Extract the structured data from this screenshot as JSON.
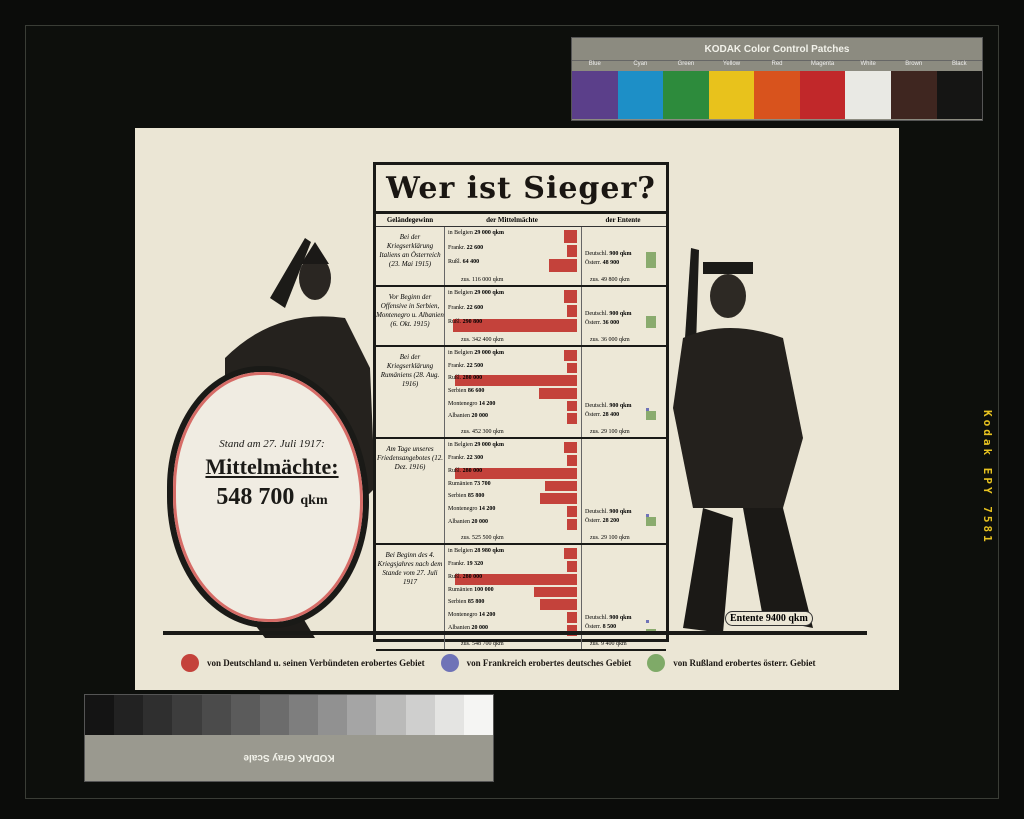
{
  "film_strip": {
    "edge_text": "Kodak EPY 7581"
  },
  "color_card": {
    "title": "KODAK Color Control Patches",
    "labels": [
      "Blue",
      "Cyan",
      "Green",
      "Yellow",
      "Red",
      "Magenta",
      "White",
      "Brown",
      "Black"
    ],
    "colors": [
      "#5b3f8a",
      "#1d8fc7",
      "#2d8b3c",
      "#e8c21c",
      "#d8531d",
      "#c1282a",
      "#e9e9e4",
      "#3f2620",
      "#151514"
    ]
  },
  "gray_card": {
    "title": "KODAK Gray Scale",
    "shades": [
      "#141414",
      "#222",
      "#2f2f2f",
      "#3d3d3d",
      "#4b4b4b",
      "#5b5b5b",
      "#6c6c6c",
      "#7e7e7e",
      "#919191",
      "#a5a5a5",
      "#babab9",
      "#cfcfce",
      "#e4e4e2",
      "#f5f5f3"
    ]
  },
  "poster": {
    "title": "Wer ist Sieger?",
    "headers": {
      "col1": "Geländegewinn",
      "col2": "der Mittelmächte",
      "col3": "der Entente"
    },
    "rows": [
      {
        "caption": "Bei der Kriegserklärung Italiens an Österreich (23. Mai 1915)",
        "mid": [
          [
            "in Belgien",
            "29 000 qkm"
          ],
          [
            "Frankr.",
            "22 600"
          ],
          [
            "Rußl.",
            "64 400"
          ]
        ],
        "mid_sum": "zus. 116 000 qkm",
        "ent": [
          [
            "Deutschl.",
            "900 qkm"
          ],
          [
            "Österr.",
            "48 900"
          ]
        ],
        "ent_sum": "zus. 49 800 qkm"
      },
      {
        "caption": "Vor Beginn der Offensive in Serbien, Montenegro u. Albanien (6. Okt. 1915)",
        "mid": [
          [
            "in Belgien",
            "29 000 qkm"
          ],
          [
            "Frankr.",
            "22 600"
          ],
          [
            "Rußl.",
            "290 800"
          ]
        ],
        "mid_sum": "zus. 342 400 qkm",
        "ent": [
          [
            "Deutschl.",
            "900 qkm"
          ],
          [
            "Österr.",
            "36 000"
          ]
        ],
        "ent_sum": "zus. 36 000 qkm"
      },
      {
        "caption": "Bei der Kriegserklärung Rumäniens (28. Aug. 1916)",
        "mid": [
          [
            "in Belgien",
            "29 000 qkm"
          ],
          [
            "Frankr.",
            "22 500"
          ],
          [
            "Rußl.",
            "280 000"
          ],
          [
            "Serbien",
            "86 600"
          ],
          [
            "Montenegro",
            "14 200"
          ],
          [
            "Albanien",
            "20 000"
          ]
        ],
        "mid_sum": "zus. 452 300 qkm",
        "ent": [
          [
            "Deutschl.",
            "900 qkm"
          ],
          [
            "Österr.",
            "28 400"
          ]
        ],
        "ent_sum": "zus. 29 100 qkm"
      },
      {
        "caption": "Am Tage unseres Friedensangebotes (12. Dez. 1916)",
        "mid": [
          [
            "in Belgien",
            "29 000 qkm"
          ],
          [
            "Frankr.",
            "22 300"
          ],
          [
            "Rußl.",
            "280 000"
          ],
          [
            "Rumänien",
            "73 700"
          ],
          [
            "Serbien",
            "85 800"
          ],
          [
            "Montenegro",
            "14 200"
          ],
          [
            "Albanien",
            "20 000"
          ]
        ],
        "mid_sum": "zus. 525 500 qkm",
        "ent": [
          [
            "Deutschl.",
            "900 qkm"
          ],
          [
            "Österr.",
            "28 200"
          ]
        ],
        "ent_sum": "zus. 29 100 qkm"
      },
      {
        "caption": "Bei Beginn des 4. Kriegsjahres nach dem Stande vom 27. Juli 1917",
        "mid": [
          [
            "in Belgien",
            "28 980 qkm"
          ],
          [
            "Frankr.",
            "19 320"
          ],
          [
            "Rußl.",
            "280 000"
          ],
          [
            "Rumänien",
            "100 000"
          ],
          [
            "Serbien",
            "85 800"
          ],
          [
            "Montenegro",
            "14 200"
          ],
          [
            "Albanien",
            "20 000"
          ]
        ],
        "mid_sum": "zus. 548 700 qkm",
        "ent": [
          [
            "Deutschl.",
            "900 qkm"
          ],
          [
            "Österr.",
            "8 500"
          ]
        ],
        "ent_sum": "zus. 9 400 qkm"
      }
    ],
    "blob": {
      "stand": "Stand am 27. Juli 1917:",
      "name": "Mittelmächte:",
      "area": "548 700",
      "unit": "qkm"
    },
    "entente_tag": "Entente 9400 qkm",
    "legend": [
      {
        "color": "#c4423b",
        "text": "von Deutschland u. seinen Verbündeten erobertes Gebiet"
      },
      {
        "color": "#6f73b7",
        "text": "von Frankreich erobertes deutsches Gebiet"
      },
      {
        "color": "#7faa68",
        "text": "von Rußland erobertes österr. Gebiet"
      }
    ]
  }
}
